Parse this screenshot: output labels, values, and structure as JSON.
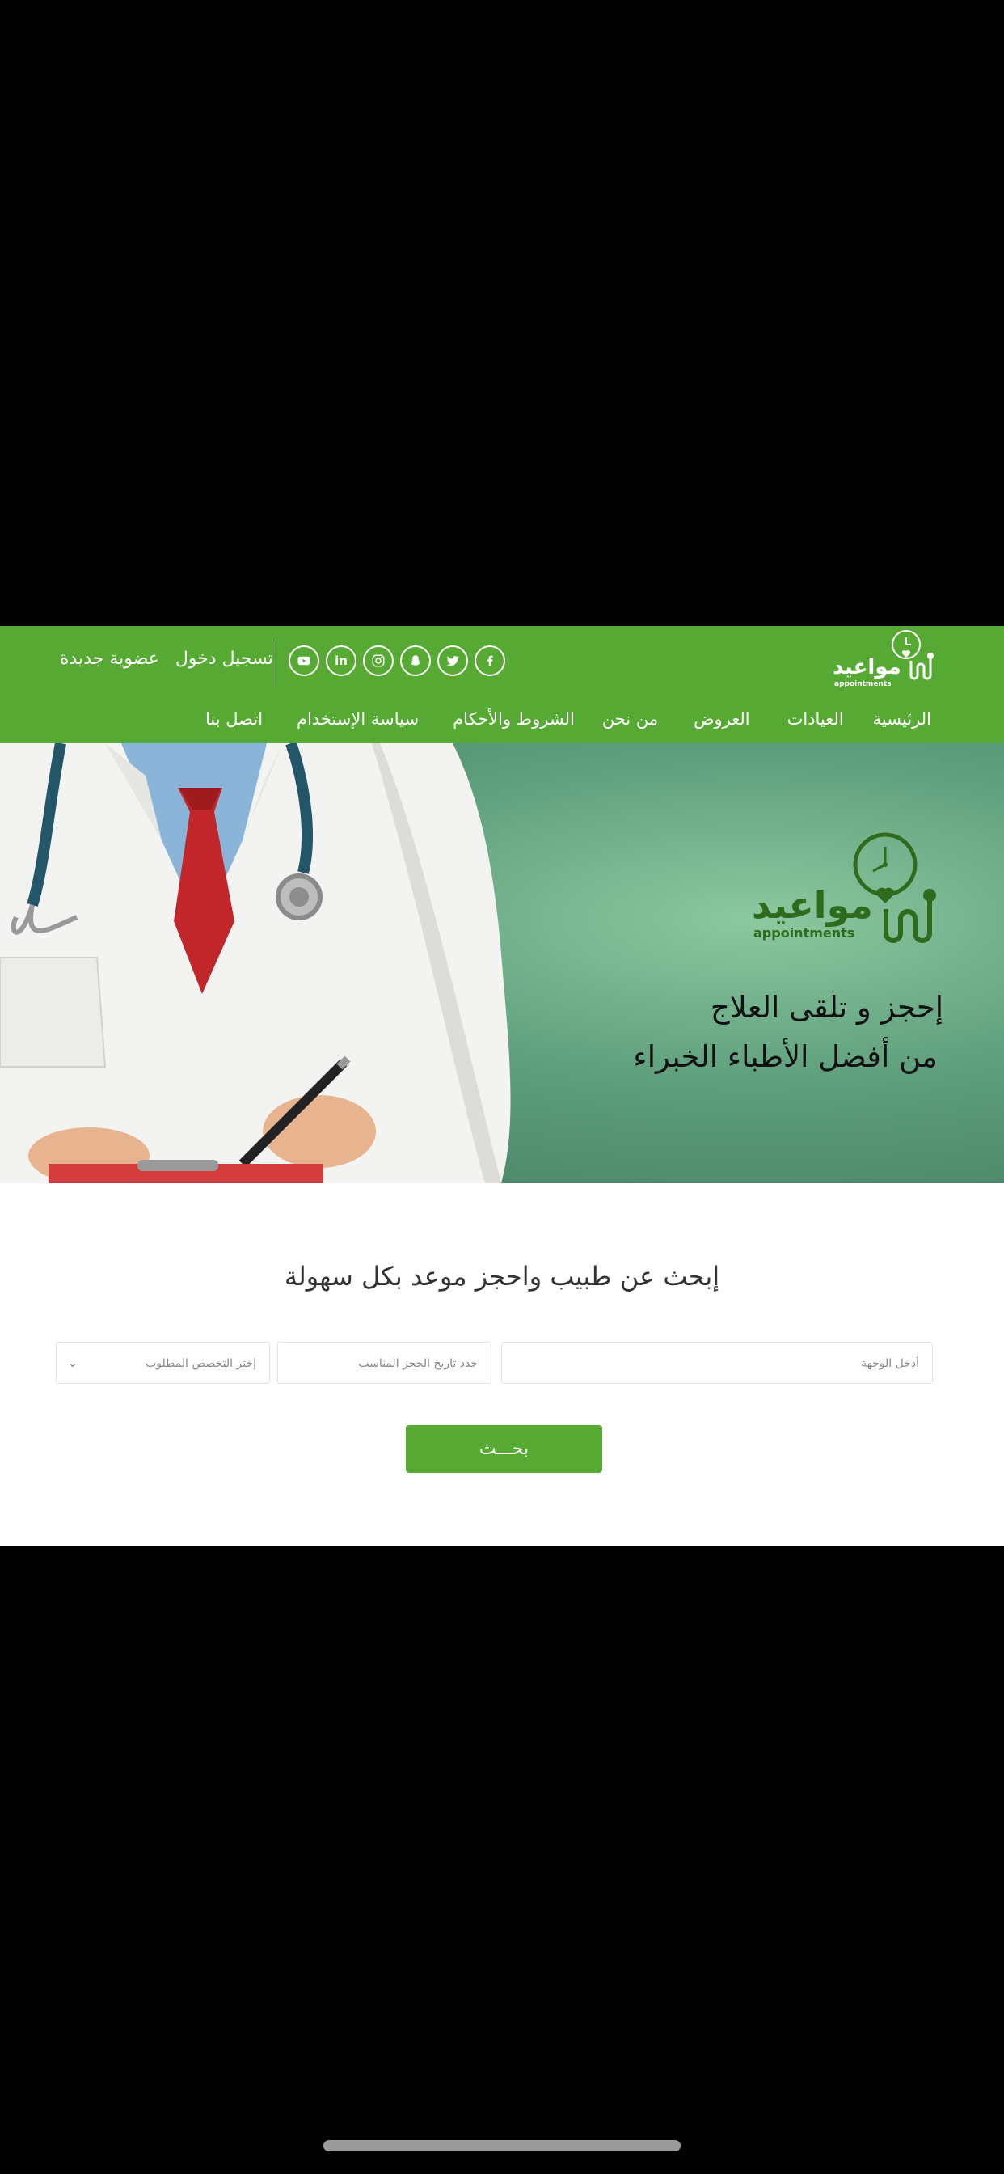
{
  "header": {
    "brand_ar": "مواعيد",
    "brand_en": "appointments",
    "account_links": [
      "تسجيل دخول",
      "عضوية جديدة"
    ],
    "social_icons": [
      "facebook-icon",
      "twitter-icon",
      "snapchat-icon",
      "instagram-icon",
      "linkedin-icon",
      "youtube-icon"
    ]
  },
  "nav": {
    "items": [
      "الرئيسية",
      "العيادات",
      "العروض",
      "من نحن",
      "الشروط والأحكام",
      "سياسة الإستخدام",
      "اتصل بنا"
    ]
  },
  "hero": {
    "logo_ar": "مواعيد",
    "logo_en": "appointments",
    "line1": "إحجز و تلقى العلاج",
    "line2": "من أفضل الأطباء الخبراء"
  },
  "search": {
    "title": "إبحث عن طبيب واحجز موعد بكل سهولة",
    "destination_placeholder": "أدخل الوجهة",
    "date_placeholder": "حدد تاريخ الحجز المناسب",
    "specialty_placeholder": "إختر التخصص المطلوب",
    "button_label": "بحـــث"
  },
  "colors": {
    "brand_green": "#56aa34",
    "logo_dark_green": "#2e6b1c"
  }
}
